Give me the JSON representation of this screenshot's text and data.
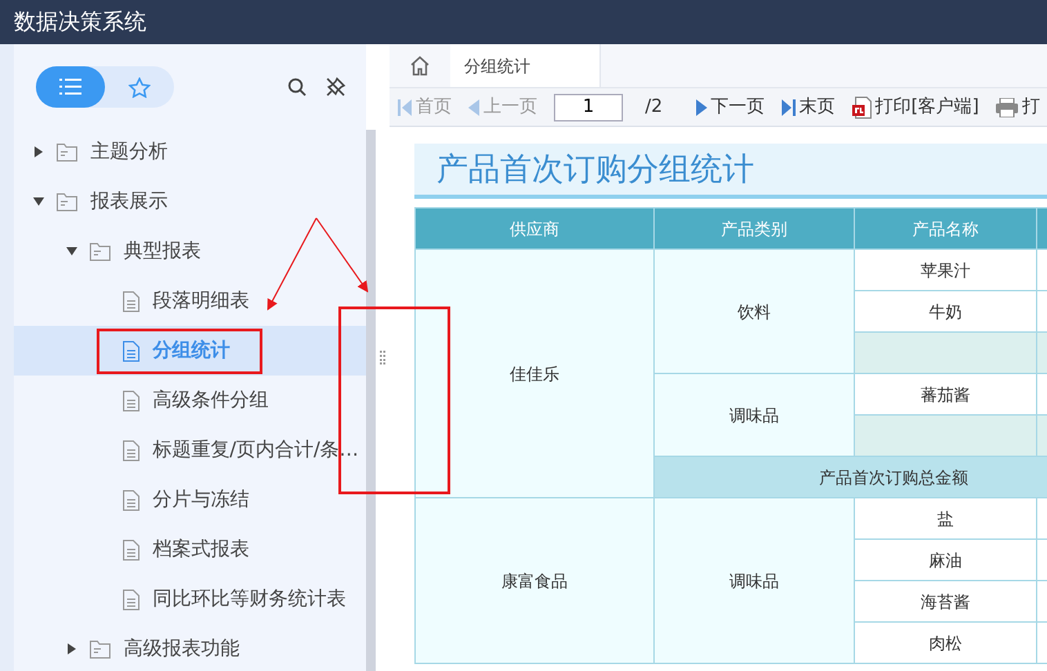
{
  "app_header": {
    "title": "数据决策系统"
  },
  "sidebar": {
    "view_toggle": [
      {
        "kind": "list",
        "selected": true
      },
      {
        "kind": "star",
        "selected": false
      }
    ],
    "tree": [
      {
        "label": "主题分析",
        "kind": "folder",
        "expanded": false,
        "selected": false
      },
      {
        "label": "报表展示",
        "kind": "folder",
        "expanded": true,
        "selected": false,
        "children": [
          {
            "label": "典型报表",
            "kind": "folder",
            "expanded": true,
            "selected": false,
            "children": [
              {
                "label": "段落明细表",
                "kind": "report",
                "selected": false
              },
              {
                "label": "分组统计",
                "kind": "report",
                "selected": true
              },
              {
                "label": "高级条件分组",
                "kind": "report",
                "selected": false
              },
              {
                "label": "标题重复/页内合计/条…",
                "kind": "report",
                "selected": false
              },
              {
                "label": "分片与冻结",
                "kind": "report",
                "selected": false
              },
              {
                "label": "档案式报表",
                "kind": "report",
                "selected": false
              },
              {
                "label": "同比环比等财务统计表",
                "kind": "report",
                "selected": false
              }
            ]
          },
          {
            "label": "高级报表功能",
            "kind": "folder",
            "expanded": false,
            "selected": false
          }
        ]
      }
    ]
  },
  "tabs": [
    {
      "label": "分组统计",
      "selected": true
    }
  ],
  "toolbar": {
    "items": [
      {
        "kind": "first",
        "label": "首页",
        "disabled": true
      },
      {
        "kind": "prev",
        "label": "上一页",
        "disabled": true
      },
      {
        "kind": "page",
        "value": "1",
        "total": "/2"
      },
      {
        "kind": "next",
        "label": "下一页",
        "disabled": false
      },
      {
        "kind": "last",
        "label": "末页",
        "disabled": false
      },
      {
        "kind": "print_client",
        "label": "打印[客户端]",
        "disabled": false
      },
      {
        "kind": "print",
        "label": "打",
        "disabled": false
      }
    ]
  },
  "report": {
    "title": "产品首次订购分组统计",
    "table": {
      "columns": [
        "供应商",
        "产品类别",
        "产品名称"
      ],
      "groups": [
        {
          "supplier": "佳佳乐",
          "categories": [
            {
              "name": "饮料",
              "products": [
                "苹果汁",
                "牛奶"
              ],
              "subtotal": true
            },
            {
              "name": "调味品",
              "products": [
                "蕃茄酱"
              ],
              "subtotal": true
            }
          ],
          "total_label": "产品首次订购总金额"
        },
        {
          "supplier": "康富食品",
          "categories": [
            {
              "name": "调味品",
              "products": [
                "盐",
                "麻油",
                "海苔酱",
                "肉松"
              ]
            }
          ]
        }
      ]
    }
  }
}
